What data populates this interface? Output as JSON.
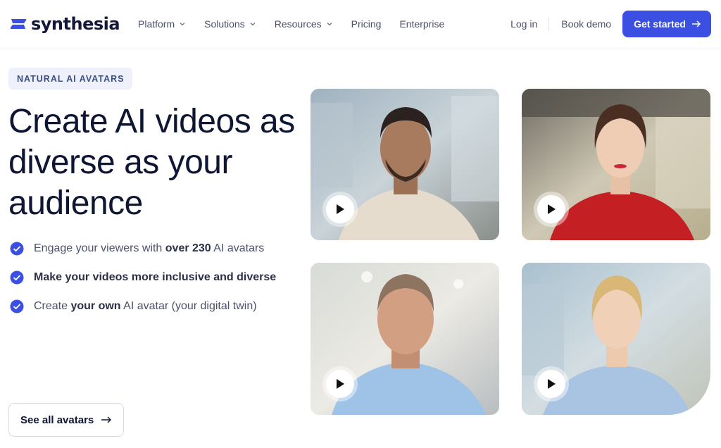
{
  "brand": {
    "name": "synthesia",
    "accent": "#3b4fe3"
  },
  "nav": {
    "items": [
      {
        "label": "Platform",
        "has_dropdown": true
      },
      {
        "label": "Solutions",
        "has_dropdown": true
      },
      {
        "label": "Resources",
        "has_dropdown": true
      },
      {
        "label": "Pricing",
        "has_dropdown": false
      },
      {
        "label": "Enterprise",
        "has_dropdown": false
      }
    ],
    "login": "Log in",
    "book_demo": "Book demo",
    "cta": "Get started"
  },
  "hero": {
    "badge": "NATURAL AI AVATARS",
    "headline": "Create AI videos as diverse as your audience",
    "bullets": [
      {
        "pre": "Engage your viewers with ",
        "bold": "over 230",
        "post": " AI avatars"
      },
      {
        "pre": "",
        "bold": "Make your videos more inclusive and diverse",
        "post": ""
      },
      {
        "pre": "Create ",
        "bold": "your own",
        "post": " AI avatar (your digital twin)"
      }
    ],
    "see_all": "See all avatars"
  },
  "videos": [
    {
      "name": "avatar-video-1",
      "icon": "play-icon"
    },
    {
      "name": "avatar-video-2",
      "icon": "play-icon"
    },
    {
      "name": "avatar-video-3",
      "icon": "play-icon"
    },
    {
      "name": "avatar-video-4",
      "icon": "play-icon"
    }
  ]
}
